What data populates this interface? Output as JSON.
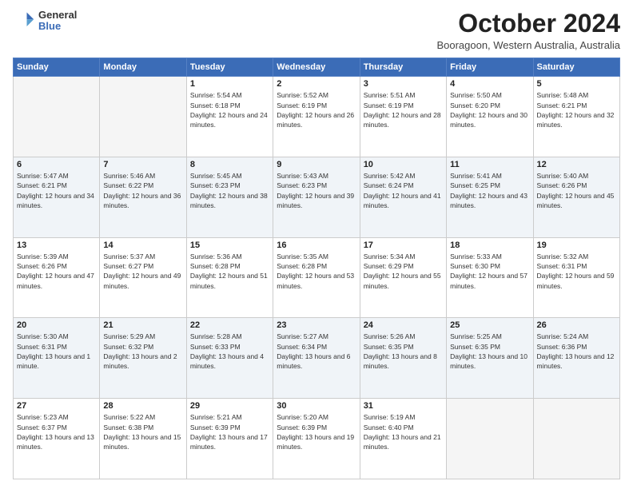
{
  "logo": {
    "general": "General",
    "blue": "Blue"
  },
  "header": {
    "month": "October 2024",
    "location": "Booragoon, Western Australia, Australia"
  },
  "weekdays": [
    "Sunday",
    "Monday",
    "Tuesday",
    "Wednesday",
    "Thursday",
    "Friday",
    "Saturday"
  ],
  "weeks": [
    [
      {
        "day": "",
        "info": ""
      },
      {
        "day": "",
        "info": ""
      },
      {
        "day": "1",
        "info": "Sunrise: 5:54 AM\nSunset: 6:18 PM\nDaylight: 12 hours and 24 minutes."
      },
      {
        "day": "2",
        "info": "Sunrise: 5:52 AM\nSunset: 6:19 PM\nDaylight: 12 hours and 26 minutes."
      },
      {
        "day": "3",
        "info": "Sunrise: 5:51 AM\nSunset: 6:19 PM\nDaylight: 12 hours and 28 minutes."
      },
      {
        "day": "4",
        "info": "Sunrise: 5:50 AM\nSunset: 6:20 PM\nDaylight: 12 hours and 30 minutes."
      },
      {
        "day": "5",
        "info": "Sunrise: 5:48 AM\nSunset: 6:21 PM\nDaylight: 12 hours and 32 minutes."
      }
    ],
    [
      {
        "day": "6",
        "info": "Sunrise: 5:47 AM\nSunset: 6:21 PM\nDaylight: 12 hours and 34 minutes."
      },
      {
        "day": "7",
        "info": "Sunrise: 5:46 AM\nSunset: 6:22 PM\nDaylight: 12 hours and 36 minutes."
      },
      {
        "day": "8",
        "info": "Sunrise: 5:45 AM\nSunset: 6:23 PM\nDaylight: 12 hours and 38 minutes."
      },
      {
        "day": "9",
        "info": "Sunrise: 5:43 AM\nSunset: 6:23 PM\nDaylight: 12 hours and 39 minutes."
      },
      {
        "day": "10",
        "info": "Sunrise: 5:42 AM\nSunset: 6:24 PM\nDaylight: 12 hours and 41 minutes."
      },
      {
        "day": "11",
        "info": "Sunrise: 5:41 AM\nSunset: 6:25 PM\nDaylight: 12 hours and 43 minutes."
      },
      {
        "day": "12",
        "info": "Sunrise: 5:40 AM\nSunset: 6:26 PM\nDaylight: 12 hours and 45 minutes."
      }
    ],
    [
      {
        "day": "13",
        "info": "Sunrise: 5:39 AM\nSunset: 6:26 PM\nDaylight: 12 hours and 47 minutes."
      },
      {
        "day": "14",
        "info": "Sunrise: 5:37 AM\nSunset: 6:27 PM\nDaylight: 12 hours and 49 minutes."
      },
      {
        "day": "15",
        "info": "Sunrise: 5:36 AM\nSunset: 6:28 PM\nDaylight: 12 hours and 51 minutes."
      },
      {
        "day": "16",
        "info": "Sunrise: 5:35 AM\nSunset: 6:28 PM\nDaylight: 12 hours and 53 minutes."
      },
      {
        "day": "17",
        "info": "Sunrise: 5:34 AM\nSunset: 6:29 PM\nDaylight: 12 hours and 55 minutes."
      },
      {
        "day": "18",
        "info": "Sunrise: 5:33 AM\nSunset: 6:30 PM\nDaylight: 12 hours and 57 minutes."
      },
      {
        "day": "19",
        "info": "Sunrise: 5:32 AM\nSunset: 6:31 PM\nDaylight: 12 hours and 59 minutes."
      }
    ],
    [
      {
        "day": "20",
        "info": "Sunrise: 5:30 AM\nSunset: 6:31 PM\nDaylight: 13 hours and 1 minute."
      },
      {
        "day": "21",
        "info": "Sunrise: 5:29 AM\nSunset: 6:32 PM\nDaylight: 13 hours and 2 minutes."
      },
      {
        "day": "22",
        "info": "Sunrise: 5:28 AM\nSunset: 6:33 PM\nDaylight: 13 hours and 4 minutes."
      },
      {
        "day": "23",
        "info": "Sunrise: 5:27 AM\nSunset: 6:34 PM\nDaylight: 13 hours and 6 minutes."
      },
      {
        "day": "24",
        "info": "Sunrise: 5:26 AM\nSunset: 6:35 PM\nDaylight: 13 hours and 8 minutes."
      },
      {
        "day": "25",
        "info": "Sunrise: 5:25 AM\nSunset: 6:35 PM\nDaylight: 13 hours and 10 minutes."
      },
      {
        "day": "26",
        "info": "Sunrise: 5:24 AM\nSunset: 6:36 PM\nDaylight: 13 hours and 12 minutes."
      }
    ],
    [
      {
        "day": "27",
        "info": "Sunrise: 5:23 AM\nSunset: 6:37 PM\nDaylight: 13 hours and 13 minutes."
      },
      {
        "day": "28",
        "info": "Sunrise: 5:22 AM\nSunset: 6:38 PM\nDaylight: 13 hours and 15 minutes."
      },
      {
        "day": "29",
        "info": "Sunrise: 5:21 AM\nSunset: 6:39 PM\nDaylight: 13 hours and 17 minutes."
      },
      {
        "day": "30",
        "info": "Sunrise: 5:20 AM\nSunset: 6:39 PM\nDaylight: 13 hours and 19 minutes."
      },
      {
        "day": "31",
        "info": "Sunrise: 5:19 AM\nSunset: 6:40 PM\nDaylight: 13 hours and 21 minutes."
      },
      {
        "day": "",
        "info": ""
      },
      {
        "day": "",
        "info": ""
      }
    ]
  ]
}
